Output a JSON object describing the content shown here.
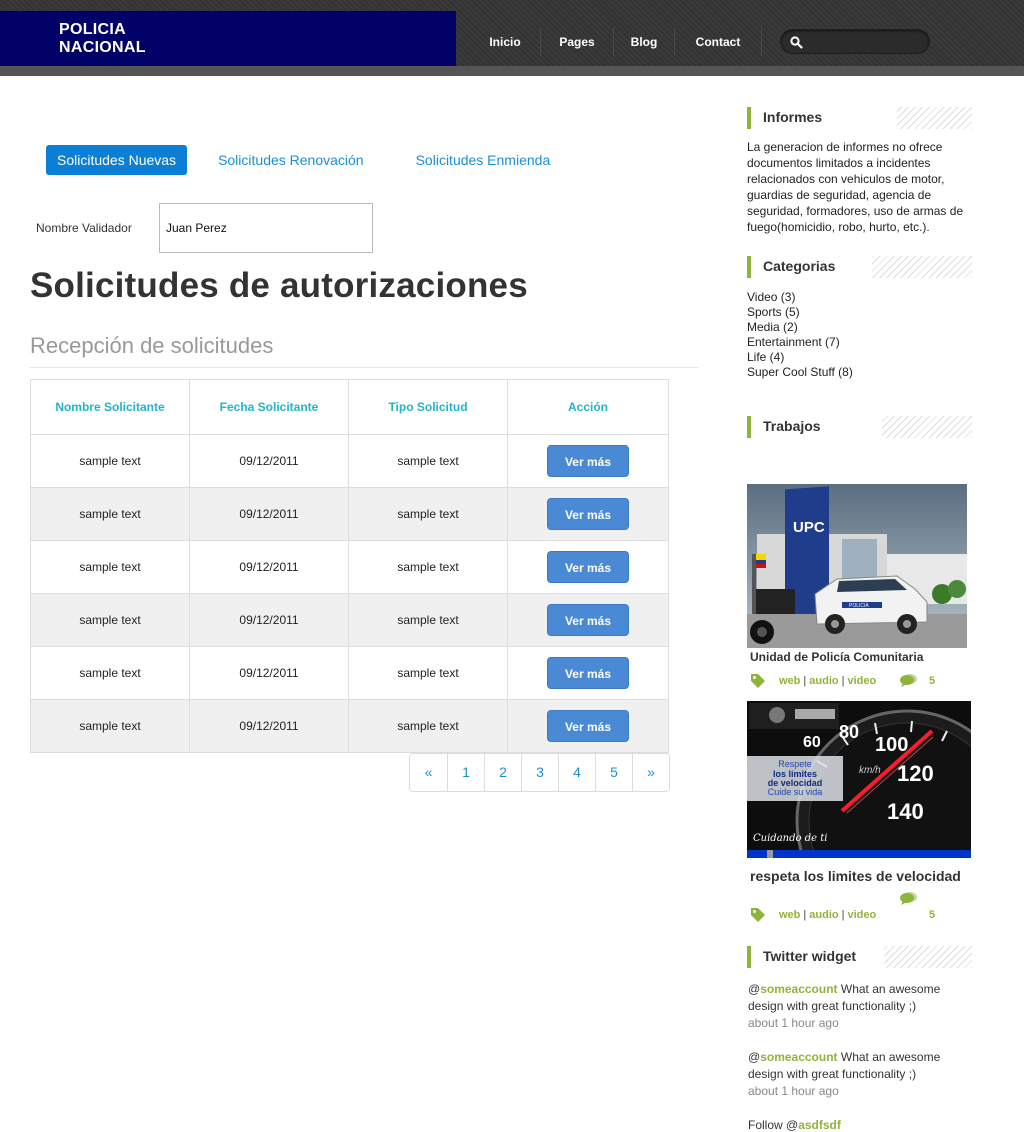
{
  "header": {
    "logo_line1": "POLICIA",
    "logo_line2": "NACIONAL",
    "nav": [
      "Inicio",
      "Pages",
      "Blog",
      "Contact"
    ],
    "search_placeholder": ""
  },
  "tabs": [
    "Solicitudes Nuevas",
    "Solicitudes Renovación",
    "Solicitudes Enmienda"
  ],
  "validator": {
    "label": "Nombre Validador",
    "value": "Juan Perez"
  },
  "page_title": "Solicitudes de autorizaciones",
  "subtitle": "Recepción de solicitudes",
  "table": {
    "headers": [
      "Nombre Solicitante",
      "Fecha Solicitante",
      "Tipo Solicitud",
      "Acción"
    ],
    "rows": [
      {
        "name": "sample text",
        "date": "09/12/2011",
        "type": "sample text",
        "action": "Ver más"
      },
      {
        "name": "sample text",
        "date": "09/12/2011",
        "type": "sample text",
        "action": "Ver más"
      },
      {
        "name": "sample text",
        "date": "09/12/2011",
        "type": "sample text",
        "action": "Ver más"
      },
      {
        "name": "sample text",
        "date": "09/12/2011",
        "type": "sample text",
        "action": "Ver más"
      },
      {
        "name": "sample text",
        "date": "09/12/2011",
        "type": "sample text",
        "action": "Ver más"
      },
      {
        "name": "sample text",
        "date": "09/12/2011",
        "type": "sample text",
        "action": "Ver más"
      }
    ]
  },
  "pagination": [
    "«",
    "1",
    "2",
    "3",
    "4",
    "5",
    "»"
  ],
  "sidebar": {
    "informes": {
      "title": "Informes",
      "text": "La generacion de informes no ofrece documentos limitados a incidentes relacionados con vehiculos de motor, guardias de seguridad, agencia de seguridad, formadores, uso de armas de fuego(homicidio, robo, hurto, etc.)."
    },
    "categorias": {
      "title": "Categorias",
      "items": [
        "Video (3)",
        "Sports (5)",
        "Media (2)",
        "Entertainment (7)",
        "Life (4)",
        "Super Cool Stuff (8)"
      ]
    },
    "trabajos": {
      "title": "Trabajos",
      "items": [
        {
          "caption": "Unidad de Policía Comunitaria",
          "tags": [
            "web",
            "audio",
            "video"
          ],
          "comments": "5",
          "sign": "UPC",
          "car_label": "POLICIA"
        },
        {
          "caption": "respeta los limites de velocidad",
          "tags": [
            "web",
            "audio",
            "video"
          ],
          "comments": "5",
          "sign_lines": [
            "Respete",
            "los límites",
            "de velocidad",
            "Cuide su vida"
          ],
          "footer_text": "Cuidando de ti",
          "speeds": [
            "60",
            "80",
            "100",
            "120",
            "140"
          ],
          "unit": "km/h"
        }
      ]
    },
    "twitter": {
      "title": "Twitter widget",
      "tweets": [
        {
          "at": "@",
          "user": "someaccount",
          "text": " What an awesome design with great functionality ;)",
          "time": "about 1 hour ago"
        },
        {
          "at": "@",
          "user": "someaccount",
          "text": " What an awesome design with great functionality ;)",
          "time": "about 1 hour ago"
        }
      ],
      "follow_prefix": "Follow @",
      "follow_user": "asdfsdf"
    }
  },
  "colors": {
    "accent_green": "#8fb43a",
    "link_blue": "#1a8fd6",
    "button_blue": "#4a89d4",
    "header_teal": "#22b5c7",
    "logo_bg": "#000066"
  }
}
